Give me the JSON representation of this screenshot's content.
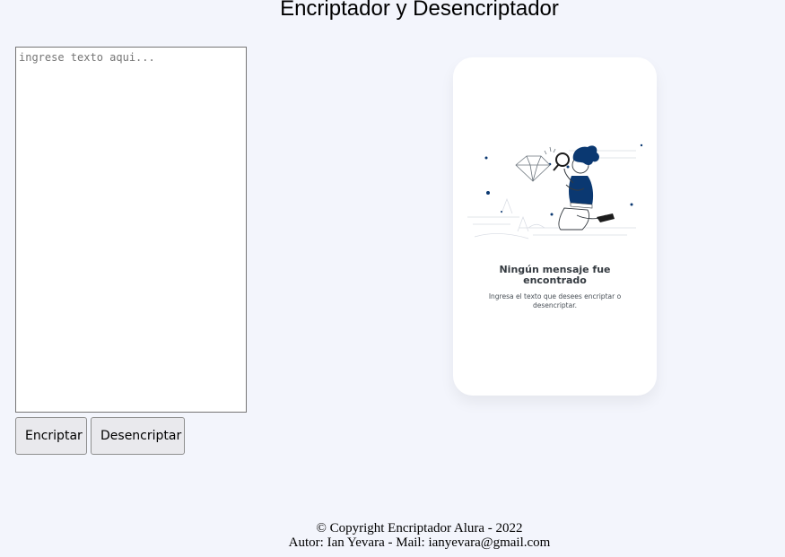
{
  "header": {
    "title": "Encriptador y Desencriptador"
  },
  "input": {
    "placeholder": "ingrese texto aqui...",
    "value": ""
  },
  "actions": {
    "encrypt_label": "Encriptar",
    "decrypt_label": "Desencriptar"
  },
  "result": {
    "empty_title": "Ningún mensaje fue encontrado",
    "empty_subtitle": "Ingresa el texto que desees encriptar o desencriptar.",
    "illustration_icon": "person-with-magnifier-illustration"
  },
  "footer": {
    "copyright": "© Copyright Encriptador Alura - 2022",
    "author": "Autor: Ian Yevara - Mail: ianyevara@gmail.com"
  },
  "colors": {
    "background": "#f3f5fc",
    "card": "#ffffff",
    "accent": "#0a3871",
    "button_bg": "#e9e9ed"
  }
}
